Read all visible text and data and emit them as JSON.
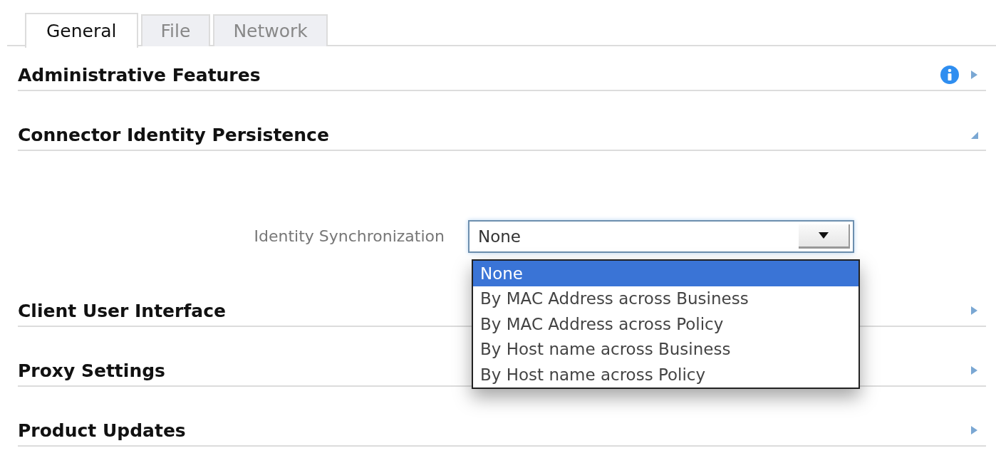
{
  "tabs": [
    {
      "label": "General",
      "selected": true
    },
    {
      "label": "File",
      "selected": false
    },
    {
      "label": "Network",
      "selected": false
    }
  ],
  "sections": [
    {
      "title": "Administrative Features",
      "expanded": false,
      "info": true
    },
    {
      "title": "Connector Identity Persistence",
      "expanded": true,
      "info": false,
      "field": {
        "label": "Identity Synchronization",
        "value": "None",
        "open": true,
        "options": [
          {
            "label": "None",
            "selected": true
          },
          {
            "label": "By MAC Address across Business",
            "selected": false
          },
          {
            "label": "By MAC Address across Policy",
            "selected": false
          },
          {
            "label": "By Host name across Business",
            "selected": false
          },
          {
            "label": "By Host name across Policy",
            "selected": false
          }
        ]
      }
    },
    {
      "title": "Client User Interface",
      "expanded": false,
      "info": false
    },
    {
      "title": "Proxy Settings",
      "expanded": false,
      "info": false
    },
    {
      "title": "Product Updates",
      "expanded": false,
      "info": false
    }
  ]
}
